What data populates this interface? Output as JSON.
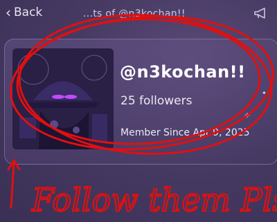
{
  "header": {
    "back_label": "Back",
    "title": "...ts of @n3kochan!!"
  },
  "profile": {
    "username": "@n3kochan!!",
    "followers": "25 followers",
    "member_since": "Member Since Apr 9, 2025"
  },
  "overlay": {
    "handwriting": "Follow them Pls"
  },
  "colors": {
    "background": "#463a62",
    "annotation_red": "#e01010"
  },
  "icons": {
    "back": "chevron-left-icon",
    "report": "megaphone-icon"
  }
}
